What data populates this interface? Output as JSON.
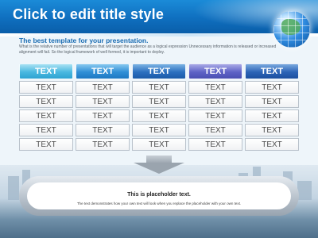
{
  "header": {
    "title": "Click to edit title style",
    "accent": "#0f6fbf"
  },
  "intro": {
    "subtitle": "The best template for your presentation.",
    "description": "What is the relative number of presentations that will target the audience as a logical expression Unnecessary information is released or increased alignment will fail. So the logical framework of well formed, it is important to deploy."
  },
  "table": {
    "headers": [
      "TEXT",
      "TEXT",
      "TEXT",
      "TEXT",
      "TEXT"
    ],
    "rows": [
      [
        "TEXT",
        "TEXT",
        "TEXT",
        "TEXT",
        "TEXT"
      ],
      [
        "TEXT",
        "TEXT",
        "TEXT",
        "TEXT",
        "TEXT"
      ],
      [
        "TEXT",
        "TEXT",
        "TEXT",
        "TEXT",
        "TEXT"
      ],
      [
        "TEXT",
        "TEXT",
        "TEXT",
        "TEXT",
        "TEXT"
      ],
      [
        "TEXT",
        "TEXT",
        "TEXT",
        "TEXT",
        "TEXT"
      ]
    ]
  },
  "placeholder": {
    "title": "This is placeholder text.",
    "text": "The text demonstrates how your own text will look when you replace the placeholder with your own text."
  },
  "icons": {
    "globe": "globe-icon",
    "arrow": "down-arrow-icon"
  }
}
